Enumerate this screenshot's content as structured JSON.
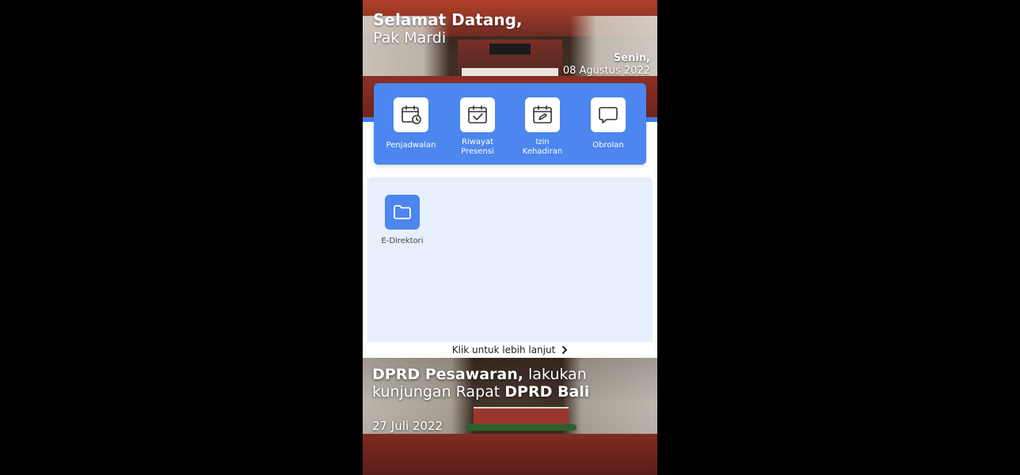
{
  "header": {
    "greeting": "Selamat Datang,",
    "user_name": "Pak Mardi",
    "day": "Senin,",
    "date": "08 Agustus 2022"
  },
  "menu": {
    "items": [
      {
        "label": "Penjadwalan",
        "icon": "calendar-clock-icon"
      },
      {
        "label": "Riwayat Presensi",
        "icon": "calendar-check-icon"
      },
      {
        "label": "Izin Kehadiran",
        "icon": "calendar-edit-icon"
      },
      {
        "label": "Obrolan",
        "icon": "chat-bubble-icon"
      }
    ]
  },
  "directory": {
    "label": "E-Direktori",
    "icon": "folder-icon"
  },
  "more_link": {
    "label": "Klik untuk lebih lanjut",
    "icon": "chevron-right-icon"
  },
  "news": {
    "title_bold_1": "DPRD Pesawaran,",
    "title_regular_1": " lakukan kunjungan Rapat ",
    "title_bold_2": "DPRD Bali",
    "date": "27 Juli 2022"
  },
  "colors": {
    "accent_blue": "#4c86ee",
    "panel_bg": "#e7effc"
  }
}
